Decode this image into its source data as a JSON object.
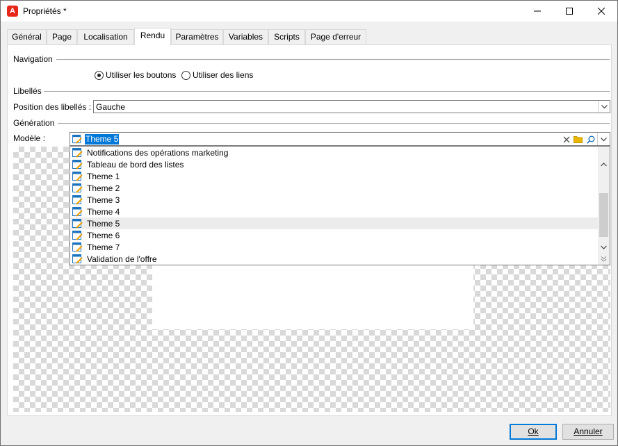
{
  "window": {
    "title": "Propriétés *",
    "icons": {
      "app": "adobe-logo-icon",
      "minimize": "minimize-icon",
      "maximize": "maximize-icon",
      "close": "close-icon"
    },
    "app_icon_glyph": "A"
  },
  "tabs": [
    {
      "label": "Général"
    },
    {
      "label": "Page"
    },
    {
      "label": "Localisation"
    },
    {
      "label": "Rendu",
      "active": true
    },
    {
      "label": "Paramètres"
    },
    {
      "label": "Variables"
    },
    {
      "label": "Scripts"
    },
    {
      "label": "Page d'erreur"
    }
  ],
  "navigation": {
    "section_label": "Navigation",
    "radio_buttons": {
      "label": "Utiliser les boutons",
      "checked": true
    },
    "radio_links": {
      "label": "Utiliser des liens",
      "checked": false
    }
  },
  "labels": {
    "section_label": "Libellés",
    "position_label": "Position des libellés :",
    "position_value": "Gauche"
  },
  "generation": {
    "section_label": "Génération",
    "model_label": "Modèle :",
    "model_value": "Theme 5",
    "tools": [
      "clear-icon",
      "folder-icon",
      "search-icon",
      "chevron-down-icon"
    ]
  },
  "dropdown": {
    "items": [
      {
        "label": "Notifications des opérations marketing"
      },
      {
        "label": "Tableau de bord des listes"
      },
      {
        "label": "Theme 1"
      },
      {
        "label": "Theme 2"
      },
      {
        "label": "Theme 3"
      },
      {
        "label": "Theme 4"
      },
      {
        "label": "Theme 5",
        "highlighted": true
      },
      {
        "label": "Theme 6"
      },
      {
        "label": "Theme 7"
      },
      {
        "label": "Validation de l'offre"
      }
    ],
    "scroll_position": 0.48
  },
  "buttons": {
    "ok": "Ok",
    "cancel": "Annuler"
  },
  "colors": {
    "accent": "#0078d7",
    "app_icon": "#e8271b",
    "template_icon_blue": "#1e73be",
    "template_icon_orange": "#f0a000",
    "folder_yellow": "#e8b500"
  }
}
